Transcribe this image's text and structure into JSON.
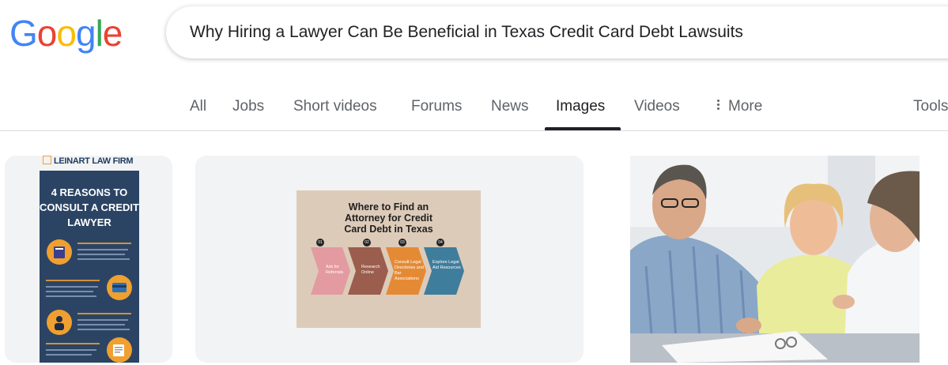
{
  "logo": {
    "letters": [
      "G",
      "o",
      "o",
      "g",
      "l",
      "e"
    ],
    "colors": [
      "#4285F4",
      "#EA4335",
      "#FBBC05",
      "#4285F4",
      "#34A853",
      "#EA4335"
    ]
  },
  "search": {
    "query": "Why Hiring a Lawyer Can Be Beneficial in Texas Credit Card Debt Lawsuits"
  },
  "tabs": {
    "all": "All",
    "jobs": "Jobs",
    "short_videos": "Short videos",
    "forums": "Forums",
    "news": "News",
    "images": "Images",
    "videos": "Videos",
    "more": "More",
    "tools": "Tools",
    "active": "Images"
  },
  "results": {
    "card1": {
      "brand": "LEINART LAW FIRM",
      "title_lines": [
        "4 REASONS TO",
        "CONSULT A CREDIT",
        "LAWYER"
      ]
    },
    "card2": {
      "title_lines": [
        "Where to Find an",
        "Attorney for Credit",
        "Card Debt in Texas"
      ],
      "steps": [
        {
          "num": "01",
          "label": "Ask for Referrals",
          "color": "#e39aa0"
        },
        {
          "num": "02",
          "label": "Research Online",
          "color": "#9b5d4d"
        },
        {
          "num": "03",
          "label": "Consult Legal Directories and Bar Associations",
          "color": "#e58a34"
        },
        {
          "num": "04",
          "label": "Explore Legal Aid Resources",
          "color": "#3f7d9c"
        }
      ]
    },
    "card3": {
      "alt": "photo-of-couple-consulting-lawyer"
    }
  }
}
